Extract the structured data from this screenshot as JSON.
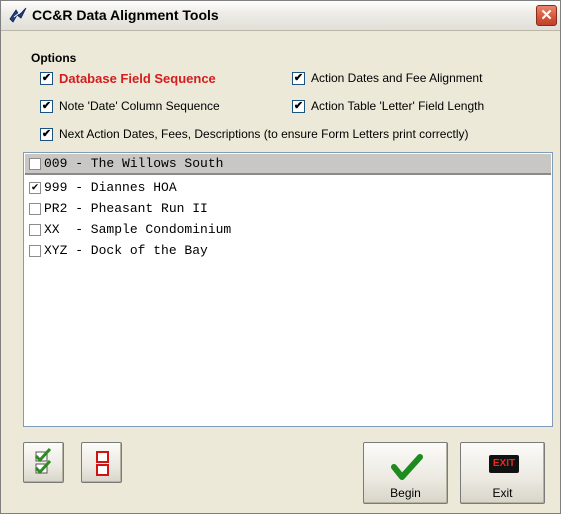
{
  "window": {
    "title": "CC&R Data Alignment Tools",
    "close_label": "✕",
    "app_icon": "feather-bird-icon"
  },
  "options": {
    "title": "Options",
    "items": [
      {
        "label": "Database Field Sequence",
        "checked": true,
        "highlight": "#d21e1e"
      },
      {
        "label": "Action Dates and Fee Alignment",
        "checked": true
      },
      {
        "label": "Note 'Date' Column Sequence",
        "checked": true
      },
      {
        "label": "Action Table 'Letter' Field Length",
        "checked": true
      },
      {
        "label": "Next Action Dates, Fees, Descriptions (to ensure Form Letters print correctly)",
        "checked": true
      }
    ]
  },
  "associations": [
    {
      "text": "009 - The Willows South",
      "checked": false,
      "selected": true
    },
    {
      "text": "999 - Diannes HOA",
      "checked": true,
      "selected": false
    },
    {
      "text": "PR2 - Pheasant Run II",
      "checked": false,
      "selected": false
    },
    {
      "text": "XX  - Sample Condominium",
      "checked": false,
      "selected": false
    },
    {
      "text": "XYZ - Dock of the Bay",
      "checked": false,
      "selected": false
    }
  ],
  "buttons": {
    "check_all_icon": "check-all-icon",
    "uncheck_all_icon": "uncheck-all-icon",
    "begin_label": "Begin",
    "begin_icon": "green-checkmark-icon",
    "exit_label": "Exit",
    "exit_badge": "EXIT"
  }
}
